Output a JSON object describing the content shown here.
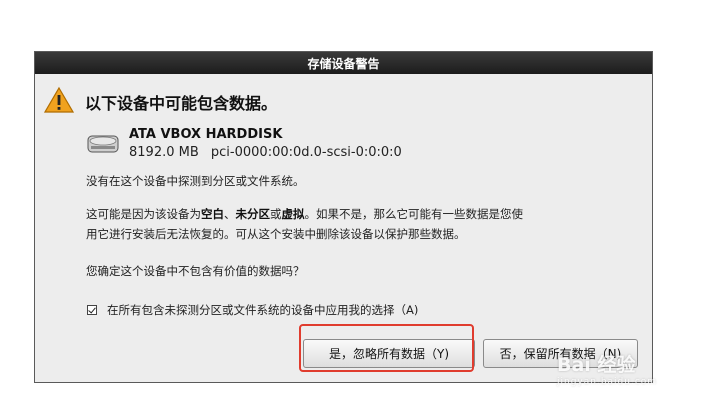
{
  "dialog": {
    "title": "存储设备警告",
    "heading": "以下设备中可能包含数据。",
    "disk": {
      "name": "ATA VBOX HARDDISK",
      "size": "8192.0 MB",
      "path": "pci-0000:00:0d.0-scsi-0:0:0:0"
    },
    "message1": "没有在这个设备中探测到分区或文件系统。",
    "message2": {
      "part1": "这可能是因为该设备为",
      "blank": "空白",
      "sep1": "、",
      "unpartitioned": "未分区",
      "sep2": "或",
      "virtual": "虚拟",
      "part2": "。如果不是，那么它可能有一些数据是您使",
      "line2": "用它进行安装后无法恢复的。可从这个安装中删除该设备以保护那些数据。"
    },
    "question": "您确定这个设备中不包含有价值的数据吗？",
    "apply_all_label": "在所有包含未探测分区或文件系统的设备中应用我的选择（A)",
    "apply_all_checked": true,
    "yes_button": "是，忽略所有数据（Y)",
    "no_button": "否，保留所有数据（N)"
  },
  "watermark": {
    "text": "Bai 经验",
    "sub": "jingyan.baidu.com"
  },
  "colors": {
    "highlight": "#e03c2e",
    "titlebar": "#1c1c1c"
  }
}
